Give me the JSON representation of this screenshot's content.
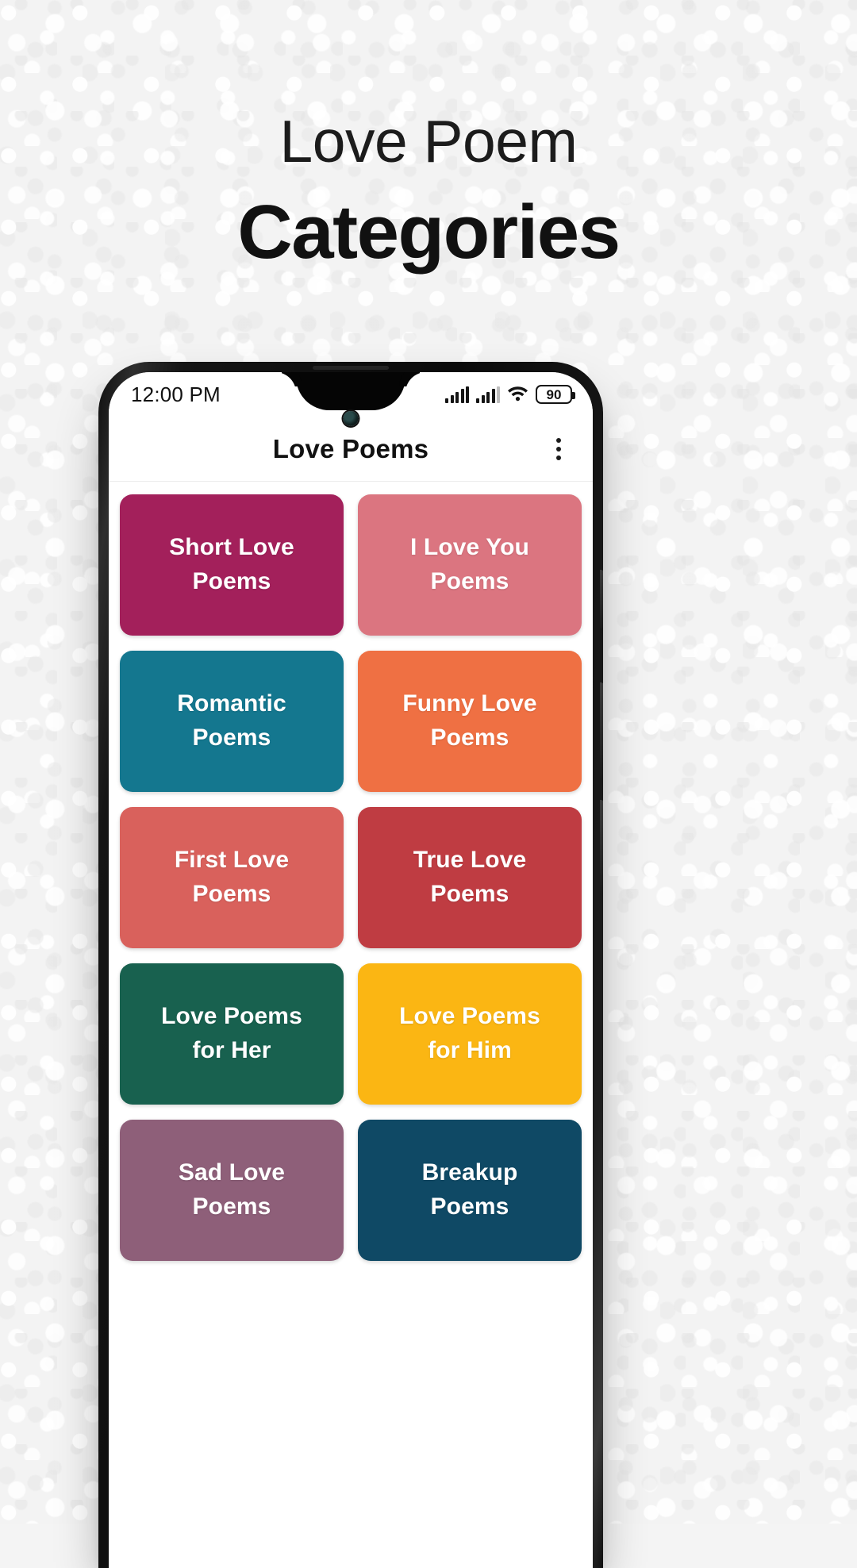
{
  "promo": {
    "title_line_1": "Love Poem",
    "title_line_2": "Categories",
    "background_color": "#f3f3f3"
  },
  "phone": {
    "status_bar": {
      "time": "12:00 PM",
      "battery_level": "90",
      "icons": [
        "signal-bars-icon",
        "signal-bars-icon",
        "wifi-icon",
        "battery-icon"
      ]
    },
    "app_bar": {
      "title": "Love Poems",
      "overflow_menu": "overflow-menu-icon"
    },
    "grid": {
      "tiles": [
        {
          "label": "Short Love\nPoems",
          "color": "#a3205b"
        },
        {
          "label": "I Love You\nPoems",
          "color": "#db7580"
        },
        {
          "label": "Romantic\nPoems",
          "color": "#14778f"
        },
        {
          "label": "Funny Love\nPoems",
          "color": "#ef7043"
        },
        {
          "label": "First Love\nPoems",
          "color": "#d9615c"
        },
        {
          "label": "True Love\nPoems",
          "color": "#bf3c42"
        },
        {
          "label": "Love Poems\nfor Her",
          "color": "#18614f"
        },
        {
          "label": "Love Poems\nfor Him",
          "color": "#fbb613"
        },
        {
          "label": "Sad Love\nPoems",
          "color": "#8e5f79"
        },
        {
          "label": "Breakup\nPoems",
          "color": "#0f4965"
        }
      ]
    }
  }
}
